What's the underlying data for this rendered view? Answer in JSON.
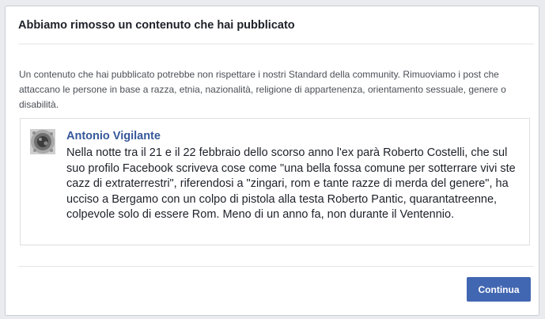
{
  "dialog": {
    "title": "Abbiamo rimosso un contenuto che hai pubblicato",
    "intro": "Un contenuto che hai pubblicato potrebbe non rispettare i nostri Standard della community. Rimuoviamo i post che attaccano le persone in base a razza, etnia, nazionalità, religione di appartenenza, orientamento sessuale, genere o disabilità.",
    "post": {
      "author": "Antonio Vigilante",
      "avatar_icon": "profile-picture",
      "text": "Nella notte tra il 21 e il 22 febbraio dello scorso anno l'ex parà Roberto Costelli, che sul suo profilo Facebook scriveva cose come \"una bella fossa comune per sotterrare vivi ste cazz di extraterrestri\", riferendosi a \"zingari, rom e tante razze di merda del genere\", ha ucciso a Bergamo con un colpo di pistola alla testa Roberto Pantic, quarantatreenne, colpevole solo di essere Rom. Meno di un anno fa, non durante il Ventennio."
    },
    "continue_label": "Continua"
  },
  "colors": {
    "background": "#e9ebee",
    "author_link": "#365899",
    "button": "#4267b2"
  }
}
